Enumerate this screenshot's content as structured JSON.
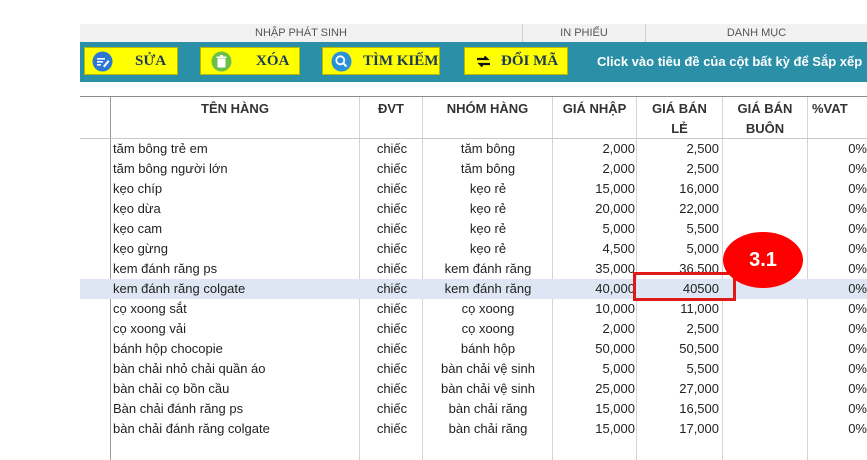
{
  "menu": {
    "nhap_phat_sinh": "NHẬP PHÁT SINH",
    "in_phieu": "IN PHIẾU",
    "danh_muc": "DANH MỤC"
  },
  "toolbar": {
    "edit_label": "SỬA",
    "delete_label": "XÓA",
    "search_label": "TÌM KIẾM",
    "swap_label": "ĐỔI MÃ",
    "hint": "Click vào tiêu đề của cột bất kỳ để Sắp xếp",
    "accent_color": "#2c8fa8",
    "button_color": "#ffff00"
  },
  "table": {
    "headers": {
      "name": "TÊN HÀNG",
      "dvt": "ĐVT",
      "group": "NHÓM HÀNG",
      "buy": "GIÁ NHẬP",
      "sell_1": "GIÁ BÁN",
      "sell_2": "LẺ",
      "whole_1": "GIÁ BÁN",
      "whole_2": "BUÔN",
      "vat": "%VAT"
    },
    "rows": [
      {
        "name": "tăm bông trẻ em",
        "dvt": "chiếc",
        "group": "tăm bông",
        "buy": "2,000",
        "sell": "2,500",
        "whole": "",
        "vat": "0%"
      },
      {
        "name": "tăm bông người lớn",
        "dvt": "chiếc",
        "group": "tăm bông",
        "buy": "2,000",
        "sell": "2,500",
        "whole": "",
        "vat": "0%"
      },
      {
        "name": "kẹo chíp",
        "dvt": "chiếc",
        "group": "kẹo rẻ",
        "buy": "15,000",
        "sell": "16,000",
        "whole": "",
        "vat": "0%"
      },
      {
        "name": "kẹo dừa",
        "dvt": "chiếc",
        "group": "kẹo rẻ",
        "buy": "20,000",
        "sell": "22,000",
        "whole": "",
        "vat": "0%"
      },
      {
        "name": "kẹo cam",
        "dvt": "chiếc",
        "group": "kẹo rẻ",
        "buy": "5,000",
        "sell": "5,500",
        "whole": "",
        "vat": "0%"
      },
      {
        "name": "kẹo gừng",
        "dvt": "chiếc",
        "group": "kẹo rẻ",
        "buy": "4,500",
        "sell": "5,000",
        "whole": "",
        "vat": "0%"
      },
      {
        "name": "kem đánh răng ps",
        "dvt": "chiếc",
        "group": "kem đánh răng",
        "buy": "35,000",
        "sell": "36,500",
        "whole": "",
        "vat": "0%"
      },
      {
        "name": "kem đánh răng colgate",
        "dvt": "chiếc",
        "group": "kem đánh răng",
        "buy": "40,000",
        "sell": "40500",
        "whole": "",
        "vat": "0%"
      },
      {
        "name": "cọ xoong sắt",
        "dvt": "chiếc",
        "group": "cọ xoong",
        "buy": "10,000",
        "sell": "11,000",
        "whole": "",
        "vat": "0%"
      },
      {
        "name": "cọ xoong vải",
        "dvt": "chiếc",
        "group": "cọ xoong",
        "buy": "2,000",
        "sell": "2,500",
        "whole": "",
        "vat": "0%"
      },
      {
        "name": "bánh hộp chocopie",
        "dvt": "chiếc",
        "group": "bánh hộp",
        "buy": "50,000",
        "sell": "50,500",
        "whole": "",
        "vat": "0%"
      },
      {
        "name": "bàn chải nhỏ chải quần áo",
        "dvt": "chiếc",
        "group": "bàn chải vệ sinh",
        "buy": "5,000",
        "sell": "5,500",
        "whole": "",
        "vat": "0%"
      },
      {
        "name": "bàn chải cọ bồn cầu",
        "dvt": "chiếc",
        "group": "bàn chải vệ sinh",
        "buy": "25,000",
        "sell": "27,000",
        "whole": "",
        "vat": "0%"
      },
      {
        "name": "Bàn chải đánh răng ps",
        "dvt": "chiếc",
        "group": "bàn chải răng",
        "buy": "15,000",
        "sell": "16,500",
        "whole": "",
        "vat": "0%"
      },
      {
        "name": "bàn chải đánh răng colgate",
        "dvt": "chiếc",
        "group": "bàn chải răng",
        "buy": "15,000",
        "sell": "17,000",
        "whole": "",
        "vat": "0%"
      }
    ],
    "selected_row": 7
  },
  "annotation": {
    "badge_label": "3.1",
    "badge_color": "#ff0000",
    "box_color": "#e01818"
  }
}
